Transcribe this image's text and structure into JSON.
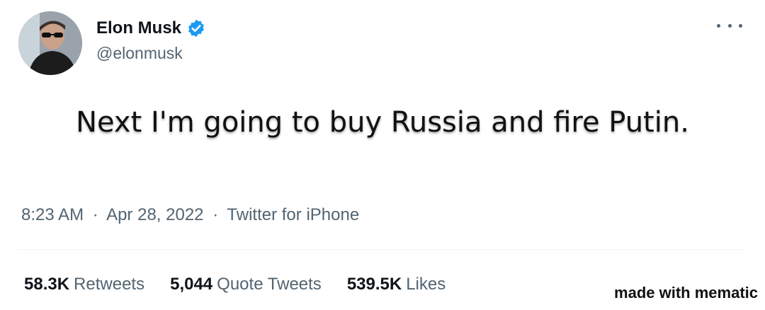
{
  "tweet": {
    "display_name": "Elon Musk",
    "handle": "@elonmusk",
    "verified_color": "#1d9bf0",
    "text": "Next I'm going to buy Russia and fire Putin.",
    "time": "8:23 AM",
    "date": "Apr 28, 2022",
    "client": "Twitter for iPhone",
    "separator": "·"
  },
  "stats": {
    "retweets_count": "58.3K",
    "retweets_label": "Retweets",
    "quotes_count": "5,044",
    "quotes_label": "Quote Tweets",
    "likes_count": "539.5K",
    "likes_label": "Likes"
  },
  "icons": {
    "more": "more-horizontal-icon",
    "verified": "verified-badge-icon"
  },
  "watermark": "made with mematic"
}
